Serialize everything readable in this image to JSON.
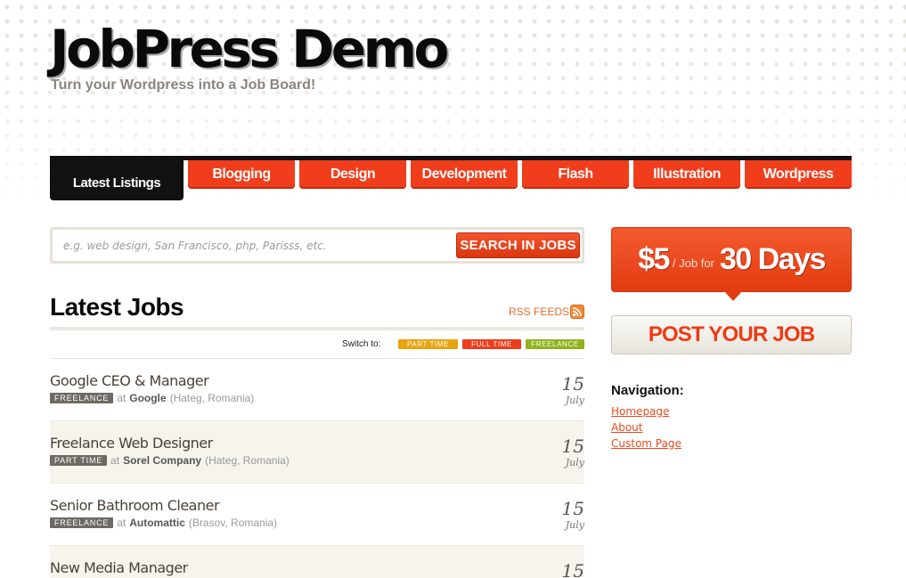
{
  "header": {
    "title": "JobPress Demo",
    "tagline": "Turn your Wordpress into a Job Board!"
  },
  "nav": {
    "active": "Latest Listings",
    "tabs": [
      "Blogging",
      "Design",
      "Development",
      "Flash",
      "Illustration",
      "Wordpress"
    ]
  },
  "search": {
    "placeholder": "e.g. web design, San Francisco, php, Parisss, etc.",
    "button": "SEARCH IN JOBS"
  },
  "jobs": {
    "title": "Latest Jobs",
    "rss": "RSS FEEDS",
    "switch_label": "Switch to:",
    "filters": [
      {
        "label": "PART TIME",
        "color": "#e8a40e"
      },
      {
        "label": "FULL TIME",
        "color": "#ee3d1b"
      },
      {
        "label": "FREELANCE",
        "color": "#8fb31a"
      }
    ],
    "items": [
      {
        "title": "Google CEO & Manager",
        "type": "FREELANCE",
        "at": "at",
        "company": "Google",
        "location": "(Hateg, Romania)",
        "day": "15",
        "month": "July"
      },
      {
        "title": "Freelance Web Designer",
        "type": "PART TIME",
        "at": "at",
        "company": "Sorel Company",
        "location": "(Hateg, Romania)",
        "day": "15",
        "month": "July"
      },
      {
        "title": "Senior Bathroom Cleaner",
        "type": "FREELANCE",
        "at": "at",
        "company": "Automattic",
        "location": "(Brasov, Romania)",
        "day": "15",
        "month": "July"
      },
      {
        "title": "New Media Manager",
        "type": "",
        "at": "",
        "company": "",
        "location": "",
        "day": "15",
        "month": ""
      }
    ]
  },
  "sidebar": {
    "price": "$5",
    "price_mid": "/ Job for",
    "days": "30 Days",
    "post_button": "POST YOUR JOB",
    "nav_heading": "Navigation:",
    "links": [
      "Homepage",
      "About",
      "Custom Page"
    ]
  },
  "colors": {
    "accent": "#f03e1c",
    "dark": "#111111"
  }
}
